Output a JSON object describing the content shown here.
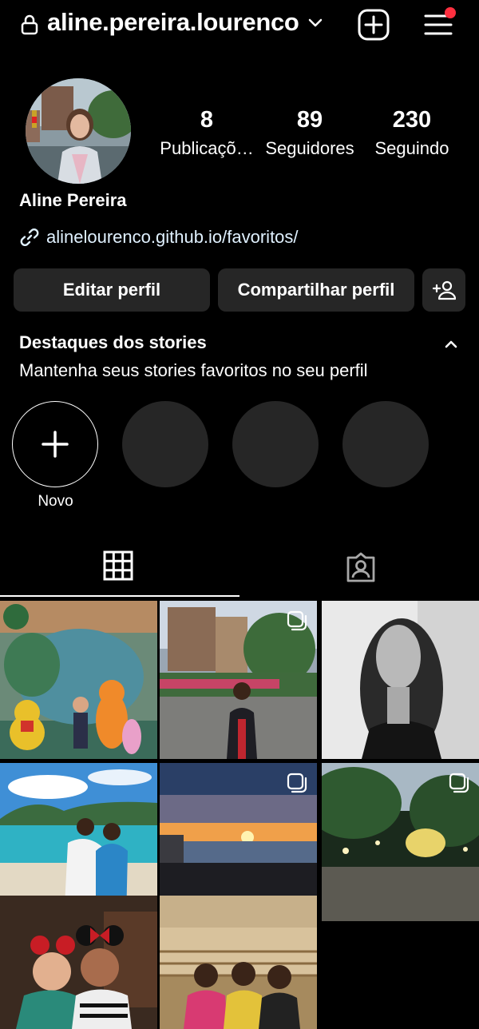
{
  "header": {
    "username": "aline.pereira.lourenco",
    "has_notification_dot": true
  },
  "profile": {
    "display_name": "Aline Pereira",
    "link": "alinelourenco.github.io/favoritos/",
    "stats": [
      {
        "value": "8",
        "label": "Publicaçõ…"
      },
      {
        "value": "89",
        "label": "Seguidores"
      },
      {
        "value": "230",
        "label": "Seguindo"
      }
    ]
  },
  "buttons": {
    "edit": "Editar perfil",
    "share": "Compartilhar perfil"
  },
  "highlights": {
    "title": "Destaques dos stories",
    "subtitle": "Mantenha seus stories favoritos no seu perfil",
    "new_label": "Novo"
  },
  "colors": {
    "background": "#000000",
    "surface": "#262626",
    "notification": "#ff3040",
    "link": "#e0f1ff"
  },
  "icons": [
    "lock-icon",
    "chevron-down-icon",
    "new-post-icon",
    "menu-icon",
    "link-icon",
    "add-person-icon",
    "chevron-up-icon",
    "plus-icon",
    "grid-icon",
    "tagged-icon",
    "carousel-icon"
  ]
}
